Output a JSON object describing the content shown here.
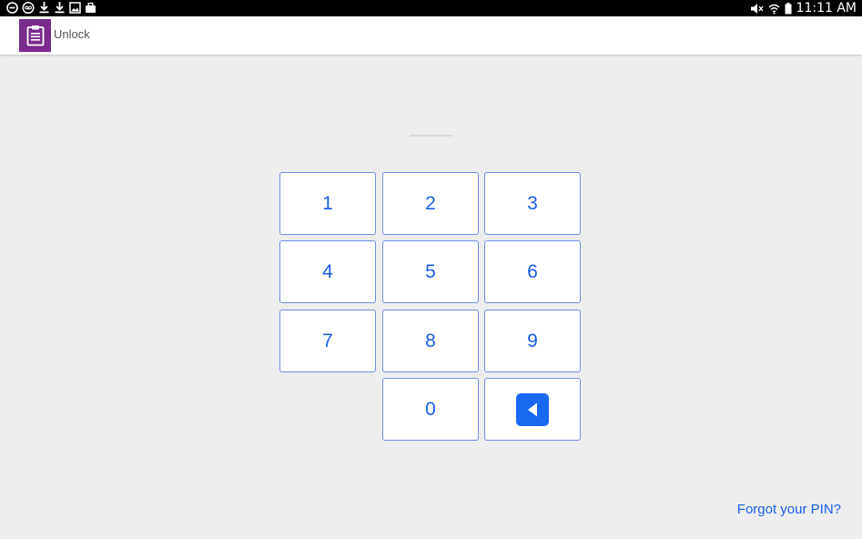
{
  "status_bar": {
    "left_icons": [
      "minus-circle-icon",
      "voicemail-icon",
      "download-icon",
      "download-icon",
      "image-icon",
      "briefcase-icon"
    ],
    "right_icons": [
      "mute-icon",
      "wifi-icon",
      "battery-icon"
    ],
    "time": "11:11 AM"
  },
  "app_bar": {
    "icon": "clipboard-icon",
    "title": "Unlock",
    "brand_color": "#7b2a8e"
  },
  "pin": {
    "entered_digits": ""
  },
  "keypad": {
    "keys": [
      "1",
      "2",
      "3",
      "4",
      "5",
      "6",
      "7",
      "8",
      "9",
      "0"
    ],
    "backspace_icon": "backspace-icon",
    "accent_color": "#1a5ee8"
  },
  "footer": {
    "forgot_link": "Forgot your PIN?"
  }
}
